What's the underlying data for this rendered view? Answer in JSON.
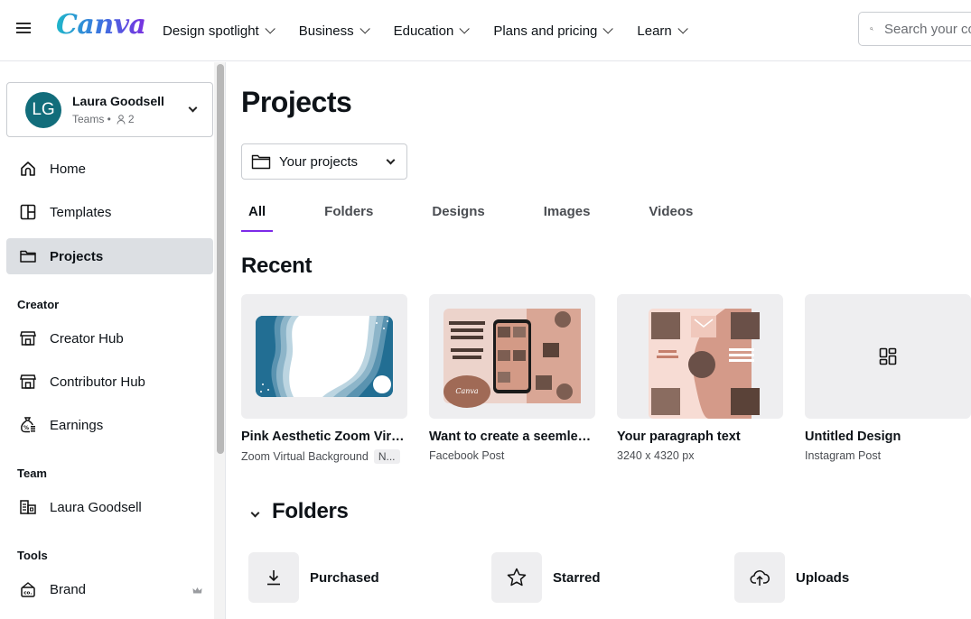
{
  "header": {
    "logo_text": "Canva",
    "nav": [
      {
        "label": "Design spotlight"
      },
      {
        "label": "Business"
      },
      {
        "label": "Education"
      },
      {
        "label": "Plans and pricing"
      },
      {
        "label": "Learn"
      }
    ],
    "search_placeholder": "Search your content"
  },
  "sidebar": {
    "account": {
      "initials": "LG",
      "name": "Laura Goodsell",
      "plan": "Teams",
      "members": "2",
      "avatar_color": "#126d7b"
    },
    "items": [
      {
        "label": "Home",
        "icon": "home-icon"
      },
      {
        "label": "Templates",
        "icon": "templates-icon"
      },
      {
        "label": "Projects",
        "icon": "folder-icon",
        "active": true
      }
    ],
    "sections": {
      "creator": {
        "title": "Creator",
        "items": [
          {
            "label": "Creator Hub",
            "icon": "store-icon"
          },
          {
            "label": "Contributor Hub",
            "icon": "store-icon"
          },
          {
            "label": "Earnings",
            "icon": "money-bag-icon"
          }
        ]
      },
      "team": {
        "title": "Team",
        "items": [
          {
            "label": "Laura Goodsell",
            "icon": "building-icon"
          }
        ]
      },
      "tools": {
        "title": "Tools",
        "items": [
          {
            "label": "Brand",
            "icon": "brand-kit-icon",
            "premium": true
          }
        ]
      }
    }
  },
  "main": {
    "title": "Projects",
    "folder_select": "Your projects",
    "tabs": [
      {
        "label": "All",
        "active": true
      },
      {
        "label": "Folders"
      },
      {
        "label": "Designs"
      },
      {
        "label": "Images"
      },
      {
        "label": "Videos"
      }
    ],
    "recent_title": "Recent",
    "recent": [
      {
        "title": "Pink Aesthetic Zoom Virtual Background",
        "subtitle": "Zoom Virtual Background",
        "badge": "N..."
      },
      {
        "title": "Want to create a seemless instagram puzzle grid?",
        "subtitle": "Facebook Post"
      },
      {
        "title": "Your paragraph text",
        "subtitle": "3240 x 4320 px"
      },
      {
        "title": "Untitled Design",
        "subtitle": "Instagram Post"
      }
    ],
    "folders_title": "Folders",
    "folders": [
      {
        "label": "Purchased",
        "icon": "download-icon"
      },
      {
        "label": "Starred",
        "icon": "star-icon"
      },
      {
        "label": "Uploads",
        "icon": "cloud-upload-icon"
      }
    ],
    "accent_color": "#7d2ae8"
  }
}
